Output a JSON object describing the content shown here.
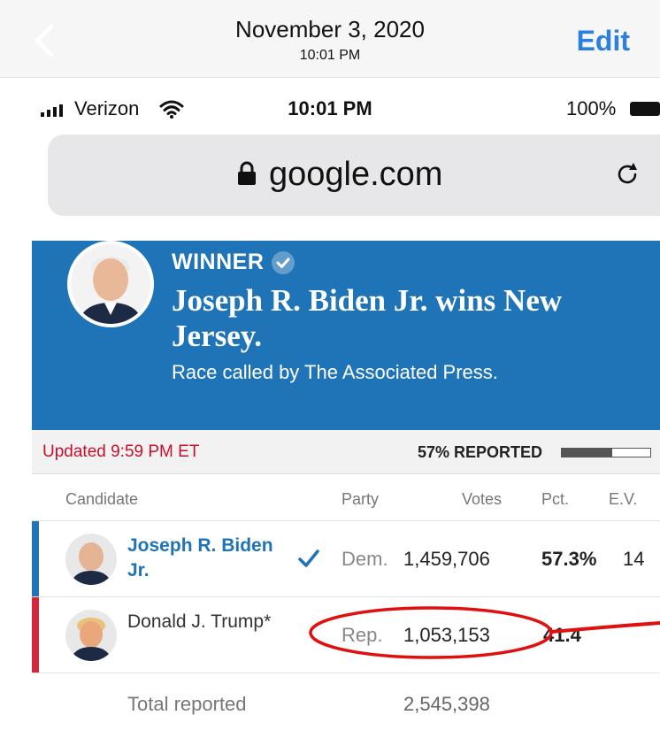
{
  "photos_header": {
    "date": "November 3, 2020",
    "time": "10:01 PM",
    "edit_label": "Edit"
  },
  "status_bar": {
    "carrier": "Verizon",
    "time": "10:01 PM",
    "battery": "100%"
  },
  "browser": {
    "url": "google.com"
  },
  "banner": {
    "winner_label": "WINNER",
    "headline": "Joseph R. Biden Jr. wins New Jersey.",
    "called_by": "Race called by The Associated Press."
  },
  "update_strip": {
    "updated": "Updated 9:59 PM ET",
    "reported": "57% REPORTED",
    "reported_fraction": 0.57
  },
  "table": {
    "headers": [
      "Candidate",
      "Party",
      "Votes",
      "Pct.",
      "E.V."
    ],
    "rows": [
      {
        "name": "Joseph R. Biden Jr.",
        "party": "Dem.",
        "votes": "1,459,706",
        "pct": "57.3%",
        "ev": "14",
        "color": "#1f73b7",
        "winner": true
      },
      {
        "name": "Donald J. Trump*",
        "party": "Rep.",
        "votes": "1,053,153",
        "pct": "41.4",
        "ev": "",
        "color": "#d0283c",
        "winner": false
      }
    ],
    "total_label": "Total reported",
    "total_votes": "2,545,398"
  },
  "colors": {
    "dem_blue": "#1f73b7",
    "rep_red": "#d0283c",
    "annotation_red": "#e01010",
    "ios_blue": "#2a7fe0"
  }
}
